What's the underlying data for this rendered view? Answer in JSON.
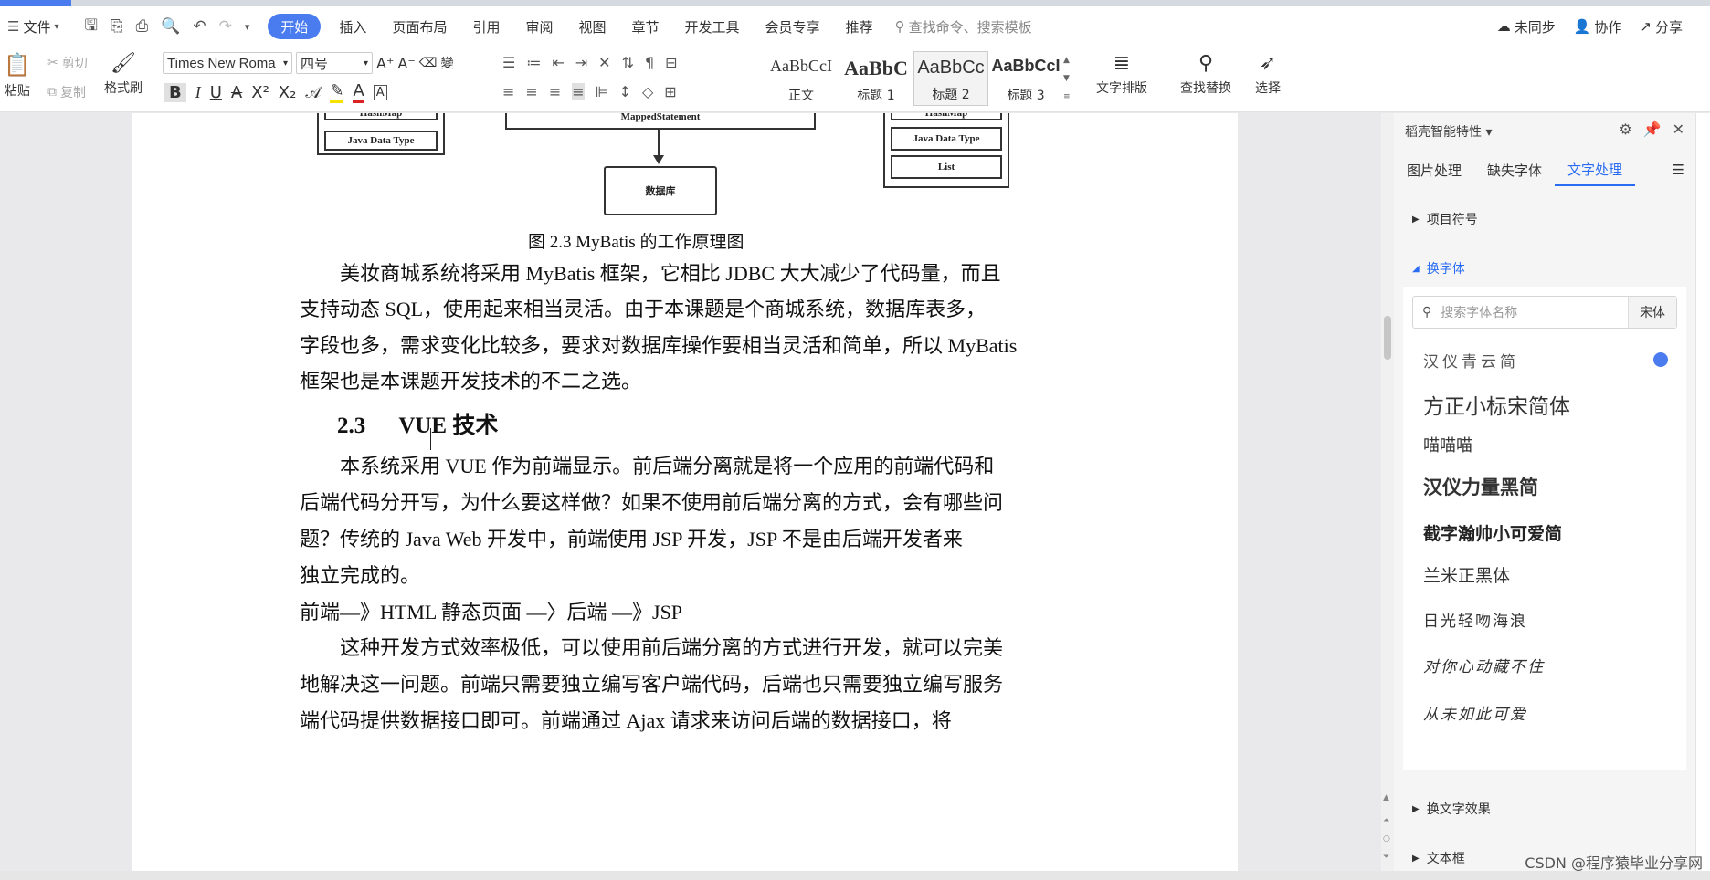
{
  "menubar": {
    "file": "文件",
    "tabs": [
      "开始",
      "插入",
      "页面布局",
      "引用",
      "审阅",
      "视图",
      "章节",
      "开发工具",
      "会员专享",
      "推荐"
    ],
    "search_placeholder": "查找命令、搜索模板",
    "unsynced": "未同步",
    "collaborate": "协作",
    "share": "分享"
  },
  "ribbon": {
    "paste": "粘贴",
    "cut": "剪切",
    "copy": "复制",
    "format_painter": "格式刷",
    "font_name": "Times New Roma",
    "font_size": "四号",
    "styles": [
      {
        "preview": "AaBbCcI",
        "label": "正文"
      },
      {
        "preview": "AaBbC",
        "label": "标题 1"
      },
      {
        "preview": "AaBbCc",
        "label": "标题 2"
      },
      {
        "preview": "AaBbCcI",
        "label": "标题 3"
      }
    ],
    "text_layout": "文字排版",
    "find_replace": "查找替换",
    "select": "选择"
  },
  "document": {
    "diagram": {
      "left_box1": "HashMap",
      "left_box2": "Java Data Type",
      "mid_top": "MappedStatement",
      "db": "数据库",
      "right_box1": "HashMap",
      "right_box2": "Java Data Type",
      "right_box3": "List"
    },
    "caption": "图 2.3 MyBatis 的工作原理图",
    "p1": [
      "　　美妆商城系统将采用 MyBatis 框架，它相比 JDBC 大大减少了代码量，而且",
      "支持动态 SQL，使用起来相当灵活。由于本课题是个商城系统，数据库表多，",
      "字段也多，需求变化比较多，要求对数据库操作要相当灵活和简单，所以 MyBatis",
      "框架也是本课题开发技术的不二之选。"
    ],
    "heading_num": "2.3",
    "heading_text": "VUE 技术",
    "p2": [
      "　　本系统采用 VUE 作为前端显示。前后端分离就是将一个应用的前端代码和",
      "后端代码分开写，为什么要这样做？如果不使用前后端分离的方式，会有哪些问",
      "题？传统的 Java Web 开发中，前端使用 JSP 开发，JSP 不是由后端开发者来",
      "独立完成的。"
    ],
    "flow": "前端—》HTML 静态页面 —〉后端 —》JSP",
    "p3": [
      "　　这种开发方式效率极低，可以使用前后端分离的方式进行开发，就可以完美",
      "地解决这一问题。前端只需要独立编写客户端代码，后端也只需要独立编写服务",
      "端代码提供数据接口即可。前端通过 Ajax 请求来访问后端的数据接口，将"
    ]
  },
  "panel": {
    "title": "稻壳智能特性",
    "tabs": [
      "图片处理",
      "缺失字体",
      "文字处理"
    ],
    "bullets": "项目符号",
    "change_font": "换字体",
    "search_placeholder": "搜索字体名称",
    "search_btn": "宋体",
    "fonts": [
      "汉仪青云简",
      "方正小标宋简体",
      "喵喵喵",
      "汉仪力量黑简",
      "截字瀚帅小可爱简",
      "兰米正黑体",
      "日光轻吻海浪",
      "对你心动藏不住",
      "从未如此可爱"
    ],
    "change_effect": "换文字效果",
    "textbox": "文本框"
  },
  "watermark": "CSDN @程序猿毕业分享网",
  "colors": {
    "accent": "#4a7cf0",
    "panel_accent": "#2a6df4"
  }
}
